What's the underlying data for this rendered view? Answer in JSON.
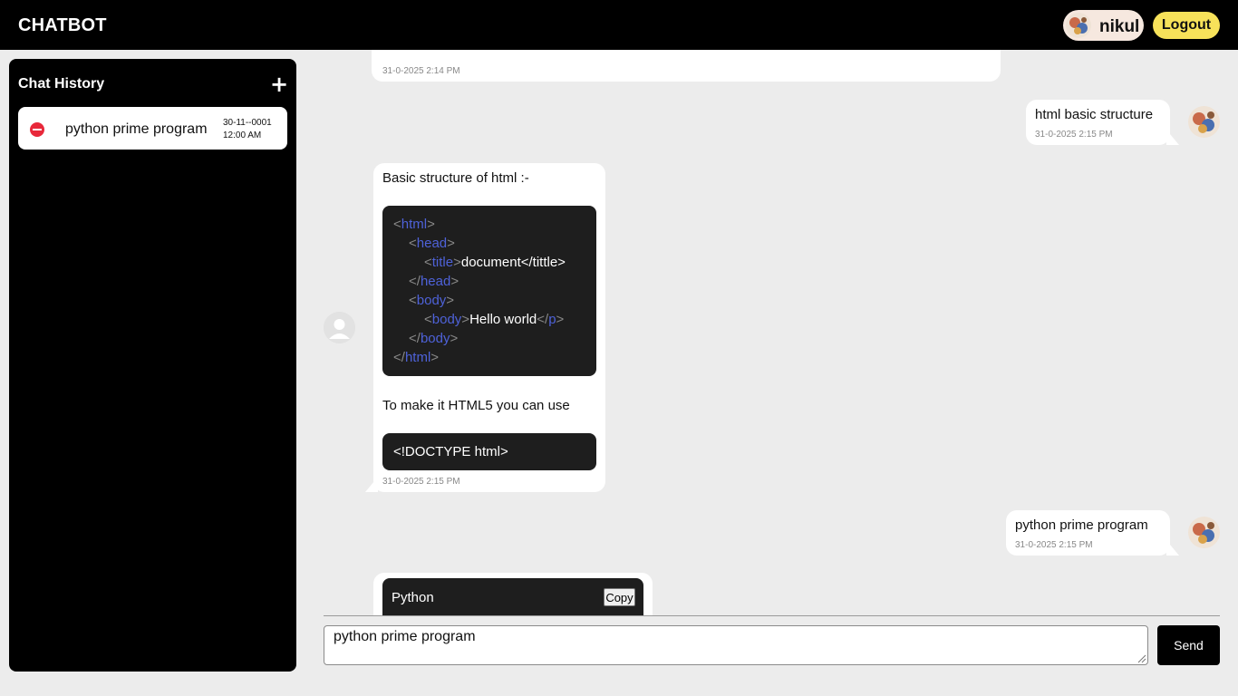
{
  "header": {
    "brand": "CHATBOT",
    "username": "nikul",
    "logout_label": "Logout"
  },
  "sidebar": {
    "title": "Chat History",
    "add_icon": "+",
    "items": [
      {
        "title": "python prime program",
        "date": "30-11--0001",
        "time": "12:00 AM"
      }
    ]
  },
  "messages": [
    {
      "role": "bot",
      "timestamp": "31-0-2025 2:14 PM"
    },
    {
      "role": "user",
      "text": "html basic structure",
      "timestamp": "31-0-2025 2:15 PM"
    },
    {
      "role": "bot",
      "intro": "Basic structure of html :-",
      "code": {
        "html_open": "html",
        "head_open": "head",
        "title_tag": "title",
        "title_text": "document</tittle>",
        "head_close": "head",
        "body_open": "body",
        "body_inner_tag": "body",
        "body_text": "Hello world",
        "p_close": "p",
        "body_close": "body",
        "html_close": "html"
      },
      "outro": "To make it HTML5 you can use",
      "doctype": "<!DOCTYPE html>",
      "timestamp": "31-0-2025 2:15 PM"
    },
    {
      "role": "user",
      "text": "python prime program",
      "timestamp": "31-0-2025 2:15 PM"
    },
    {
      "role": "bot",
      "code_lang": "Python",
      "copy_label": "Copy"
    }
  ],
  "input": {
    "value": "python prime program",
    "send_label": "Send"
  },
  "colors": {
    "topbar": "#000000",
    "logout_bg": "#f7e25a",
    "user_chip_bg": "#f6e8df",
    "delete_icon": "#e8283a",
    "code_tag": "#4e62d9",
    "code_bg": "#1e1e1e",
    "page_bg": "#ececec"
  }
}
